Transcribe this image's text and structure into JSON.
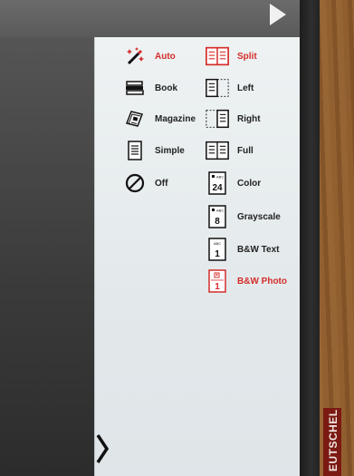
{
  "panel": {
    "left_items": [
      {
        "label": "Auto",
        "icon": "magic-wand-icon",
        "active": true
      },
      {
        "label": "Book",
        "icon": "book-stack-icon",
        "active": false
      },
      {
        "label": "Magazine",
        "icon": "magazine-icon",
        "active": false
      },
      {
        "label": "Simple",
        "icon": "simple-document-icon",
        "active": false
      },
      {
        "label": "Off",
        "icon": "off-icon",
        "active": false
      }
    ],
    "right_items": [
      {
        "label": "Split",
        "icon": "split-pages-icon",
        "active": true
      },
      {
        "label": "Left",
        "icon": "left-page-icon",
        "active": false
      },
      {
        "label": "Right",
        "icon": "right-page-icon",
        "active": false
      },
      {
        "label": "Full",
        "icon": "full-pages-icon",
        "active": false
      },
      {
        "label": "Color",
        "icon": "color-mode-icon",
        "icon_text": "24",
        "icon_small": "ABC",
        "active": false
      },
      {
        "label": "Grayscale",
        "icon": "grayscale-mode-icon",
        "icon_text": "8",
        "icon_small": "ABC",
        "active": false
      },
      {
        "label": "B&W Text",
        "icon": "bw-text-mode-icon",
        "icon_text": "1",
        "icon_small": "ABC",
        "active": false
      },
      {
        "label": "B&W Photo",
        "icon": "bw-photo-mode-icon",
        "icon_text": "1",
        "icon_small": "",
        "active": true
      }
    ]
  },
  "brand": {
    "text": "EUTSCHEL"
  },
  "colors": {
    "accent": "#d42d2a",
    "panel": "#e7edf0",
    "text": "#222222"
  }
}
